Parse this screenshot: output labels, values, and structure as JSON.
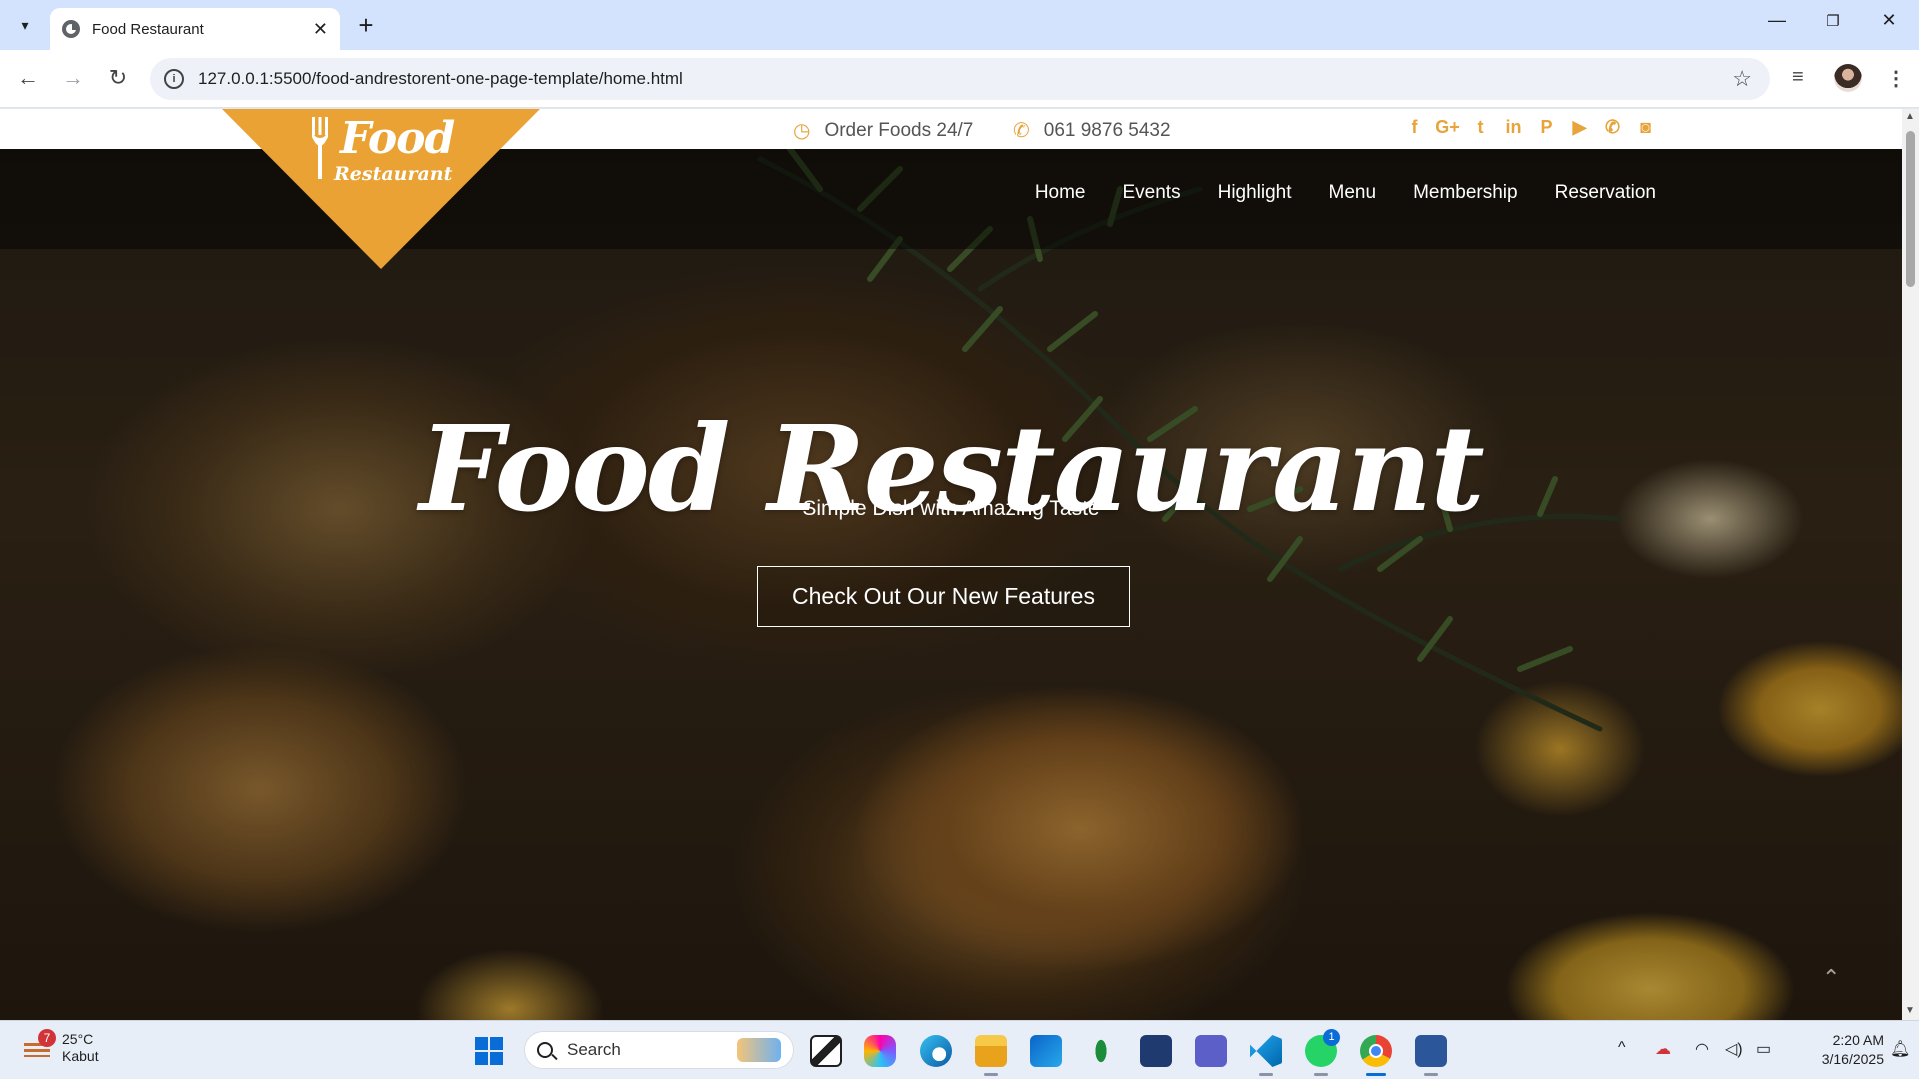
{
  "browser": {
    "tab_title": "Food Restaurant",
    "url": "127.0.0.1:5500/food-andrestorent-one-page-template/home.html"
  },
  "topbar": {
    "order_text": "Order Foods 24/7",
    "phone": "061 9876 5432",
    "socials": [
      "facebook-icon",
      "google-plus-icon",
      "twitter-icon",
      "linkedin-icon",
      "pinterest-icon",
      "youtube-icon",
      "phone-icon",
      "camera-icon"
    ]
  },
  "logo": {
    "line1": "Food",
    "line2": "Restaurant"
  },
  "nav": {
    "items": [
      {
        "label": "Home"
      },
      {
        "label": "Events"
      },
      {
        "label": "Highlight"
      },
      {
        "label": "Menu"
      },
      {
        "label": "Membership"
      },
      {
        "label": "Reservation"
      }
    ]
  },
  "hero": {
    "title": "Food Restaurant",
    "subtitle": "Simple Dish with Amazing Taste",
    "cta": "Check Out Our New Features"
  },
  "taskbar": {
    "weather_temp": "25°C",
    "weather_desc": "Kabut",
    "weather_badge": "7",
    "search_label": "Search",
    "whatsapp_badge": "1",
    "time": "2:20 AM",
    "date": "3/16/2025"
  },
  "colors": {
    "accent": "#e9a233",
    "chrome_tabstrip": "#d3e3fd",
    "taskbar": "#e7eef7"
  }
}
